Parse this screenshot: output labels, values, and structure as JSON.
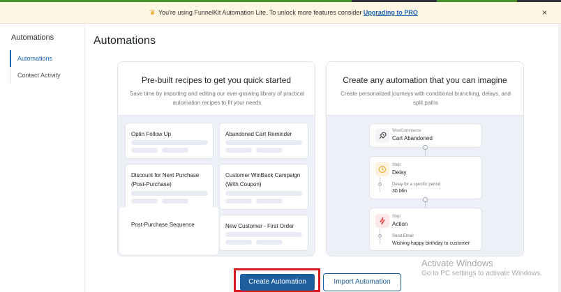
{
  "notice": {
    "text": "You're using FunnelKit Automation Lite. To unlock more features consider",
    "link": "Upgrading to PRO",
    "close": "×"
  },
  "sidebar": {
    "heading": "Automations",
    "items": [
      {
        "label": "Automations",
        "active": true
      },
      {
        "label": "Contact Activity",
        "active": false
      }
    ]
  },
  "page": {
    "title": "Automations"
  },
  "recipes_card": {
    "title": "Pre-built recipes to get you quick started",
    "subtitle": "Save time by importing and editing our ever-growing library of practical automation recipes to fit your needs",
    "recipes": [
      {
        "label": "Optin Follow Up"
      },
      {
        "label": "Abandoned Cart Reminder"
      },
      {
        "label": "Discount for Next Purchase (Post-Purchase)"
      },
      {
        "label": "Customer WinBack Campaign (With Coupon)"
      },
      {
        "label": "Post-Purchase Sequence"
      },
      {
        "label": "New Customer - First Order"
      }
    ]
  },
  "builder_card": {
    "title": "Create any automation that you can imagine",
    "subtitle": "Create personalized journeys with conditional branching, delays, and split paths",
    "trigger": {
      "small": "WooCommerce",
      "label": "Cart Abandoned"
    },
    "delay": {
      "small": "Step",
      "label": "Delay",
      "sub1": "Delay for a specific period",
      "sub2": "30 Min"
    },
    "action": {
      "small": "Step",
      "label": "Action",
      "sub1": "Send Email",
      "sub2": "Wishing happy birthday to customer"
    }
  },
  "buttons": {
    "create": "Create Automation",
    "import": "Import Automation"
  },
  "watermark": {
    "line1": "Activate Windows",
    "line2": "Go to PC settings to activate Windows."
  },
  "colors": {
    "primary": "#1d5f9e",
    "highlight": "#d71920",
    "notice_bg": "#fdf6e3"
  }
}
